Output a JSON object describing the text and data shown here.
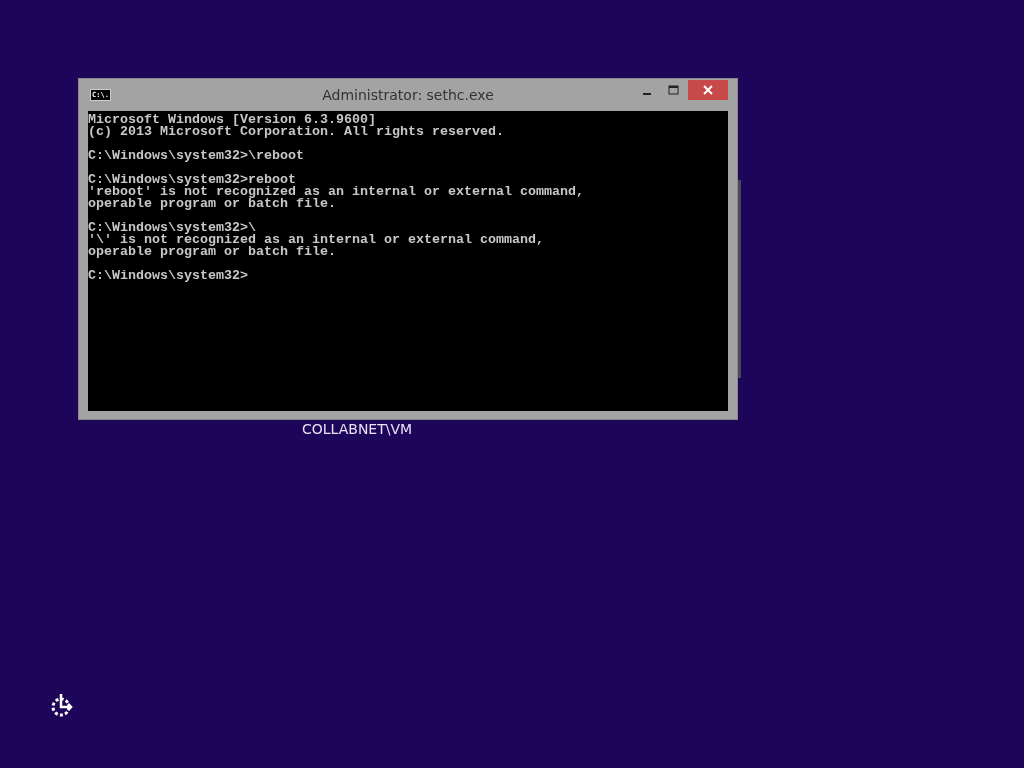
{
  "window": {
    "title": "Administrator: sethc.exe",
    "icon_text": "C:\\.",
    "console_blocks": [
      [
        "Microsoft Windows [Version 6.3.9600]",
        "(c) 2013 Microsoft Corporation. All rights reserved."
      ],
      [
        "C:\\Windows\\system32>\\reboot"
      ],
      [
        "C:\\Windows\\system32>reboot",
        "'reboot' is not recognized as an internal or external command,",
        "operable program or batch file."
      ],
      [
        "C:\\Windows\\system32>\\",
        "'\\' is not recognized as an internal or external command,",
        "operable program or batch file."
      ],
      [
        "C:\\Windows\\system32>"
      ]
    ]
  },
  "user_name": "COLLABNET\\VM"
}
